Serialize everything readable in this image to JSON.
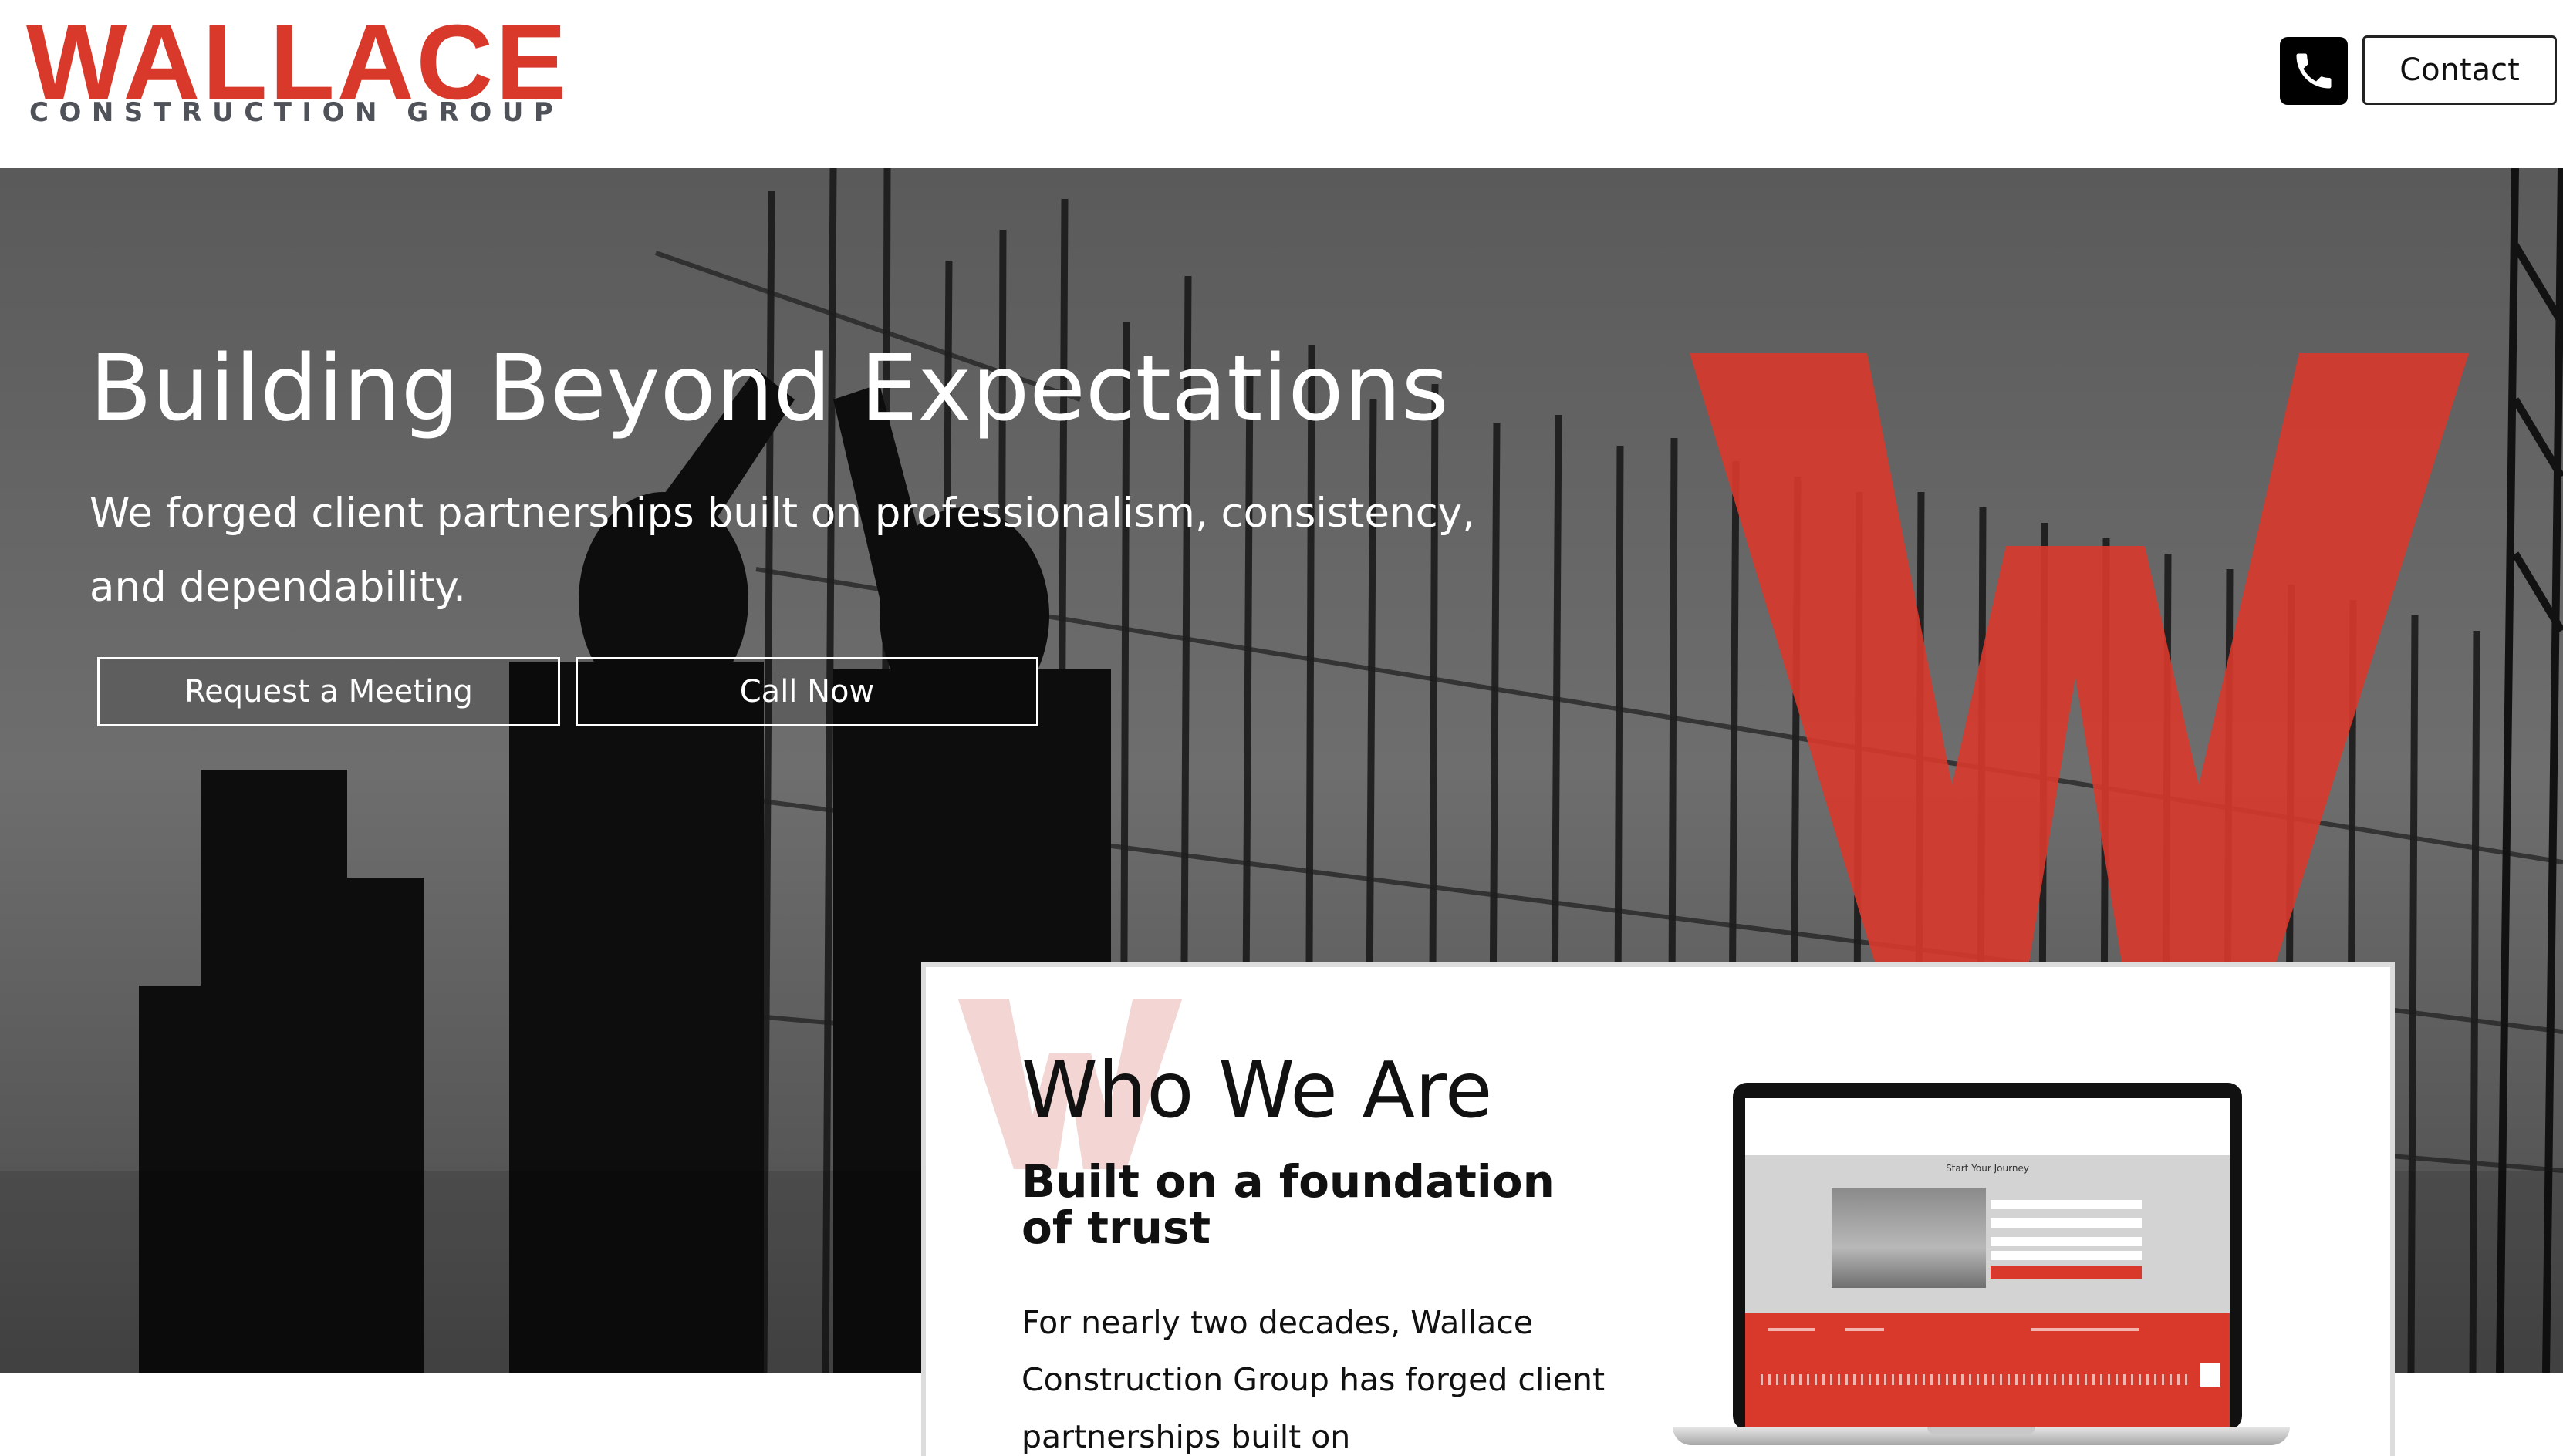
{
  "brand": {
    "name": "WALLACE",
    "tagline": "CONSTRUCTION GROUP",
    "accent_color": "#d8392b",
    "gray_color": "#4f5259"
  },
  "header": {
    "phone_icon": "phone-icon",
    "contact_label": "Contact"
  },
  "hero": {
    "title": "Building Beyond Expectations",
    "subtitle": "We forged client partnerships built on professionalism, consistency, and dependability.",
    "buttons": {
      "meeting": "Request a Meeting",
      "call": "Call Now"
    },
    "watermark": "W"
  },
  "about": {
    "title": "Who We Are",
    "subtitle": "Built on a foundation of trust",
    "body": "For nearly two decades, Wallace Construction Group has forged client partnerships built on professionalism,",
    "mockup": {
      "form_title": "Start Your Journey"
    }
  }
}
